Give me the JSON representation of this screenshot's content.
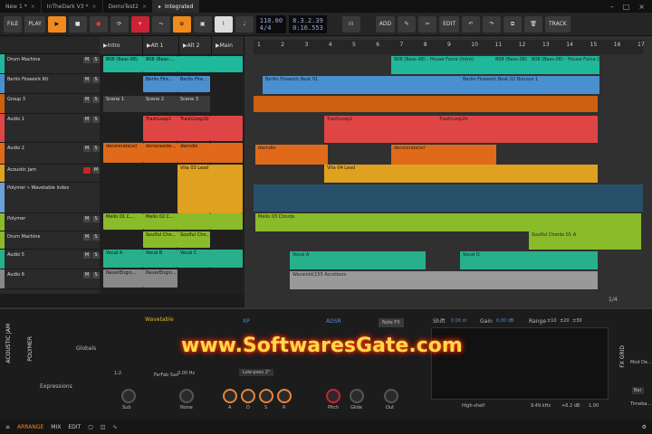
{
  "tabs": [
    {
      "label": "New 1 *"
    },
    {
      "label": "InTheDark V3 *"
    },
    {
      "label": "DemoTest2"
    },
    {
      "label": "Integrated",
      "active": true
    }
  ],
  "toolbar": {
    "file": "FILE",
    "play": "PLAY",
    "tempo": "110.00",
    "signature": "4/4",
    "position": "8.3.2.39",
    "time": "0:16.553",
    "add": "ADD",
    "edit": "EDIT",
    "track": "TRACK"
  },
  "scenes": [
    "Intro",
    "Alt 1",
    "Alt 2",
    "Main"
  ],
  "scene_clips": [
    "Scene 1",
    "Scene 2",
    "Scene 3"
  ],
  "tracks": [
    {
      "name": "Drum Machine",
      "color": "#1fb89a"
    },
    {
      "name": "Berlin Firework Kit",
      "color": "#4a8fd0"
    },
    {
      "name": "Group 3",
      "color": "#cc6010"
    },
    {
      "name": "Audio 1",
      "color": "#e04545"
    },
    {
      "name": "Audio 2",
      "color": "#e06a1a"
    },
    {
      "name": "Acoustic Jam",
      "color": "#e0a020"
    },
    {
      "name": "Polymer » Wavetable Index",
      "color": "#6aa0d8"
    },
    {
      "name": "Polymer",
      "color": "#8abb2a"
    },
    {
      "name": "Drum Machine",
      "color": "#8abb2a"
    },
    {
      "name": "Audio 5",
      "color": "#28b08c"
    },
    {
      "name": "Audio 6",
      "color": "#888888"
    }
  ],
  "launcher_clips": [
    {
      "label": "808 (Bass-08)",
      "color": "#1fb89a"
    },
    {
      "label": "808 (Bass-...",
      "color": "#1fb89a"
    },
    {
      "label": "Berlin Fire...",
      "color": "#4a8fd0"
    },
    {
      "label": "Berlin Fire...",
      "color": "#4a8fd0"
    },
    {
      "label": "TrashLoop1",
      "color": "#e04545"
    },
    {
      "label": "TrashLoop2b",
      "color": "#e04545"
    },
    {
      "label": "decelerate(sil",
      "color": "#e06a1a"
    },
    {
      "label": "dorianeede...",
      "color": "#e06a1a"
    },
    {
      "label": "dwindle",
      "color": "#e06a1a"
    },
    {
      "label": "Vita 03 Lead",
      "color": "#e0a020"
    },
    {
      "label": "Mello 01 C...",
      "color": "#8abb2a"
    },
    {
      "label": "Mello 02 C...",
      "color": "#8abb2a"
    },
    {
      "label": "Soulful Cho...",
      "color": "#8abb2a"
    },
    {
      "label": "Soulful Cho...",
      "color": "#8abb2a"
    },
    {
      "label": "Vocal A",
      "color": "#28b08c"
    },
    {
      "label": "Vocal B",
      "color": "#28b08c"
    },
    {
      "label": "Vocal C",
      "color": "#28b08c"
    },
    {
      "label": "NeverEngin...",
      "color": "#888888"
    },
    {
      "label": "NeverEngin...",
      "color": "#888888"
    }
  ],
  "ruler": [
    "1",
    "2",
    "3",
    "4",
    "5",
    "6",
    "7",
    "8",
    "9",
    "10",
    "11",
    "12",
    "13",
    "14",
    "15",
    "16",
    "17"
  ],
  "arrange_clips": [
    {
      "label": "808 (Bass-08) - House Force (Intro)",
      "color": "#1fb89a"
    },
    {
      "label": "808 (Bass-08)",
      "color": "#1fb89a"
    },
    {
      "label": "808 (Bass-08) - House Force (Fill)",
      "color": "#1fb89a"
    },
    {
      "label": "Berlin Firework Beat 01",
      "color": "#4a8fd0"
    },
    {
      "label": "Berlin Firework Beat 02 Bounce 1",
      "color": "#4a8fd0"
    },
    {
      "label": "TrashLoop1",
      "color": "#e04545"
    },
    {
      "label": "TrashLoop2b",
      "color": "#e04545"
    },
    {
      "label": "dwindle",
      "color": "#e06a1a"
    },
    {
      "label": "decelerate(sil",
      "color": "#e06a1a"
    },
    {
      "label": "Vita 04 Lead",
      "color": "#e0a020"
    },
    {
      "label": "Mello 03 Chords",
      "color": "#8abb2a"
    },
    {
      "label": "Soulful Chords 01 A",
      "color": "#8abb2a"
    },
    {
      "label": "Vocal A",
      "color": "#28b08c"
    },
    {
      "label": "Vocal D",
      "color": "#28b08c"
    },
    {
      "label": "Wavsiold(155 Accolours",
      "color": "#888888"
    }
  ],
  "arrange_zoom": "1/4",
  "device": {
    "track_label": "ACOUSTIC JAM",
    "polymer": "POLYMER",
    "wavetable": "Wavetable",
    "xp": "XP",
    "adsr": "ADSR",
    "note_fx": "Note FX",
    "globals": "Globals",
    "expressions": "Expressions",
    "filter": "Low-pass 2\"",
    "knob_labels": [
      "Sub",
      "Noise",
      "A",
      "D",
      "S",
      "R",
      "Pitch",
      "Glide",
      "Out"
    ],
    "shift": "Shift",
    "shift_val": "0.00 st",
    "gain": "Gain",
    "gain_val": "0.00 dB",
    "range": "Range",
    "range_vals": [
      "±10",
      "±20",
      "±30"
    ],
    "eq_band": "High-shelf",
    "eq_freq": "9.49 kHz",
    "eq_gain": "+6.2 dB",
    "eq_q": "1.00",
    "fx_grid": "FX GRID",
    "mod_dest": "Mod De...",
    "bar": "Bar",
    "timeline": "Timeba...",
    "index_val": "1:2",
    "freq_val": "0.00 Hz",
    "fm_label": "FarFab Sax"
  },
  "footer": {
    "arrange": "ARRANGE",
    "mix": "MIX",
    "edit": "EDIT"
  },
  "watermark": "www.SoftwaresGate.com",
  "colors": {
    "accent": "#f08a1c",
    "bg": "#1b1b1b"
  }
}
